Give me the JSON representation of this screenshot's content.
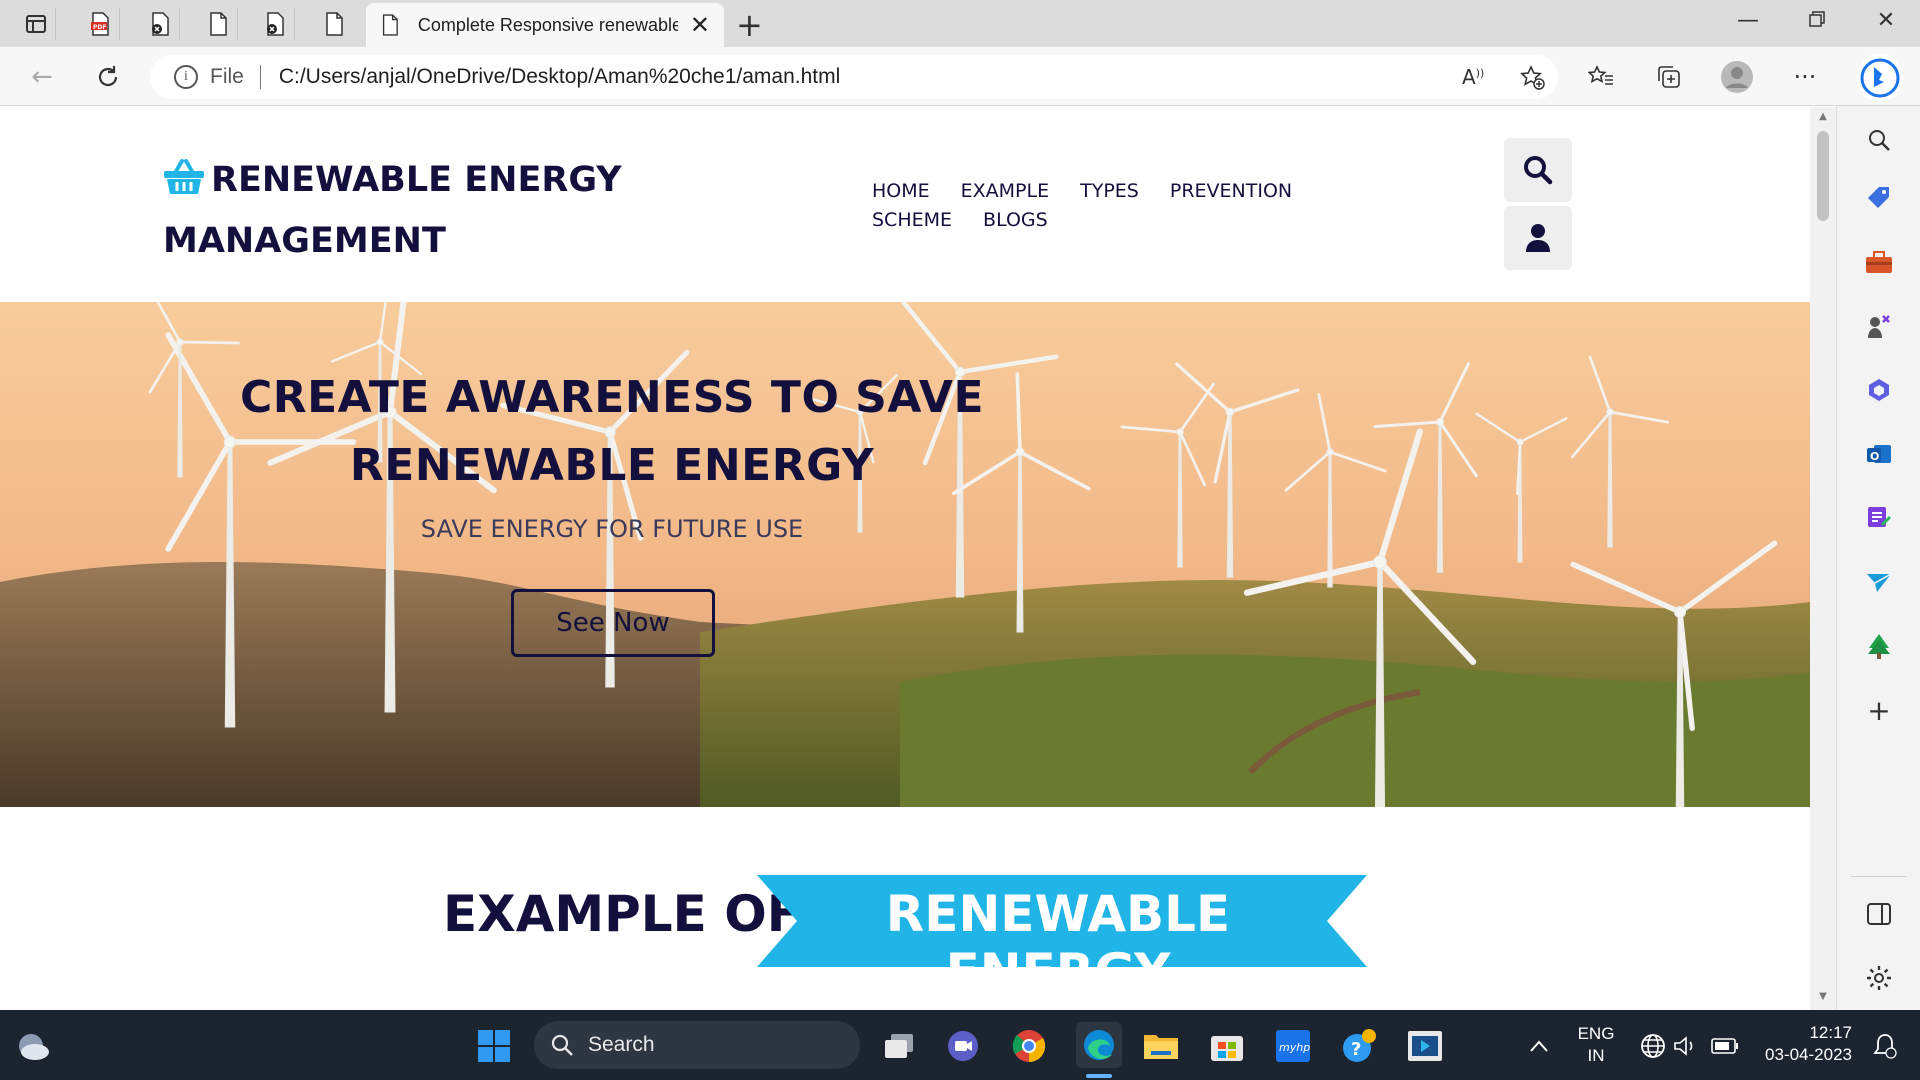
{
  "browser": {
    "active_tab_title": "Complete Responsive renewable energy management",
    "url_scheme_label": "File",
    "url": "C:/Users/anjal/OneDrive/Desktop/Aman%20che1/aman.html"
  },
  "site": {
    "logo_text": "RENEWABLE ENERGY MANAGEMENT",
    "nav": [
      "HOME",
      "EXAMPLE",
      "TYPES",
      "PREVENTION",
      "SCHEME",
      "BLOGS"
    ],
    "hero": {
      "title": "CREATE AWARENESS TO SAVE RENEWABLE ENERGY",
      "subtitle": "SAVE ENERGY FOR FUTURE USE",
      "button": "See Now"
    },
    "section": {
      "heading_plain": "EXAMPLE OF",
      "heading_highlight": "RENEWABLE ENERGY"
    },
    "colors": {
      "brand_dark": "#13103e",
      "accent": "#21b4e6"
    }
  },
  "taskbar": {
    "search_label": "Search",
    "lang_line1": "ENG",
    "lang_line2": "IN",
    "time": "12:17",
    "date": "03-04-2023"
  }
}
